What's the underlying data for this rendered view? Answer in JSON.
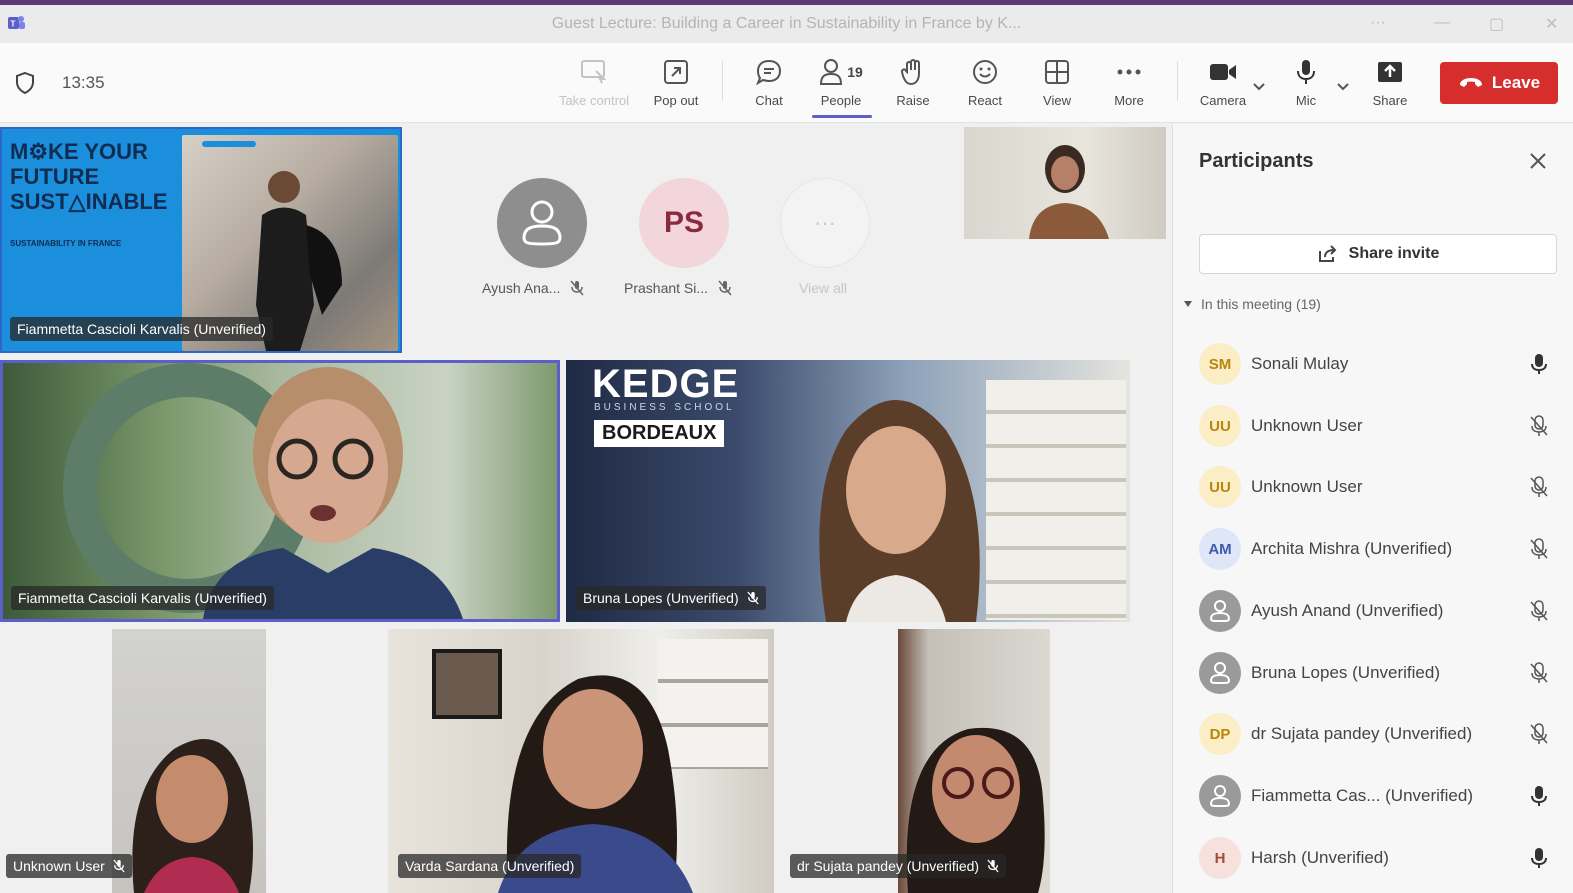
{
  "window": {
    "title": "Guest Lecture: Building a Career in Sustainability in France by K...",
    "more": "···",
    "minimize": "—",
    "maximize": "▢",
    "close": "✕"
  },
  "toolbar": {
    "time": "13:35",
    "take_control": "Take control",
    "pop_out": "Pop out",
    "chat": "Chat",
    "people": "People",
    "people_count": "19",
    "raise": "Raise",
    "react": "React",
    "view": "View",
    "more": "More",
    "camera": "Camera",
    "mic": "Mic",
    "share": "Share",
    "leave": "Leave"
  },
  "stage": {
    "shared_slide": {
      "line1": "M⚙KE YOUR",
      "line2": "FUTURE",
      "line3": "SUST△INABLE",
      "subtitle": "SUSTAINABILITY IN FRANCE",
      "nametag": "Fiammetta Cascioli Karvalis (Unverified)"
    },
    "avatars": [
      {
        "initials": "",
        "label": "Ayush Ana..."
      },
      {
        "initials": "PS",
        "label": "Prashant Si..."
      },
      {
        "initials": "···",
        "label": "View all"
      }
    ],
    "speaker_tile": {
      "nametag": "Fiammetta Cascioli Karvalis (Unverified)"
    },
    "kedge_tile": {
      "logo": "KEDGE",
      "logo_sub": "BUSINESS SCHOOL",
      "badge": "BORDEAUX",
      "nametag": "Bruna Lopes (Unverified)"
    },
    "bottom_tiles": [
      {
        "nametag": "Unknown User"
      },
      {
        "nametag": "Varda Sardana (Unverified)"
      },
      {
        "nametag": "dr Sujata pandey (Unverified)"
      }
    ]
  },
  "panel": {
    "title": "Participants",
    "share_invite": "Share invite",
    "section": "In this meeting (19)",
    "participants": [
      {
        "initials": "SM",
        "name": "Sonali Mulay",
        "mic": "on",
        "bg": "#fbeec6",
        "fg": "#b8860b"
      },
      {
        "initials": "UU",
        "name": "Unknown User",
        "mic": "off",
        "bg": "#fbeec6",
        "fg": "#b8860b"
      },
      {
        "initials": "UU",
        "name": "Unknown User",
        "mic": "off",
        "bg": "#fbeec6",
        "fg": "#b8860b"
      },
      {
        "initials": "AM",
        "name": "Archita Mishra (Unverified)",
        "mic": "off",
        "bg": "#dfe6f7",
        "fg": "#3c5ab0"
      },
      {
        "initials": "",
        "name": "Ayush Anand (Unverified)",
        "mic": "off",
        "bg": "#9a9a9a",
        "fg": "#fff"
      },
      {
        "initials": "",
        "name": "Bruna Lopes (Unverified)",
        "mic": "off",
        "bg": "#9a9a9a",
        "fg": "#fff"
      },
      {
        "initials": "DP",
        "name": "dr Sujata pandey (Unverified)",
        "mic": "off",
        "bg": "#fbeec6",
        "fg": "#b8860b"
      },
      {
        "initials": "",
        "name": "Fiammetta Cas... (Unverified)",
        "mic": "on",
        "bg": "#9a9a9a",
        "fg": "#fff"
      },
      {
        "initials": "H",
        "name": "Harsh (Unverified)",
        "mic": "on",
        "bg": "#f6e1dc",
        "fg": "#a04a3a"
      }
    ]
  },
  "colors": {
    "accent": "#5b5fc7",
    "leave": "#d62d2d",
    "slide_blue": "#1c8fdc"
  }
}
